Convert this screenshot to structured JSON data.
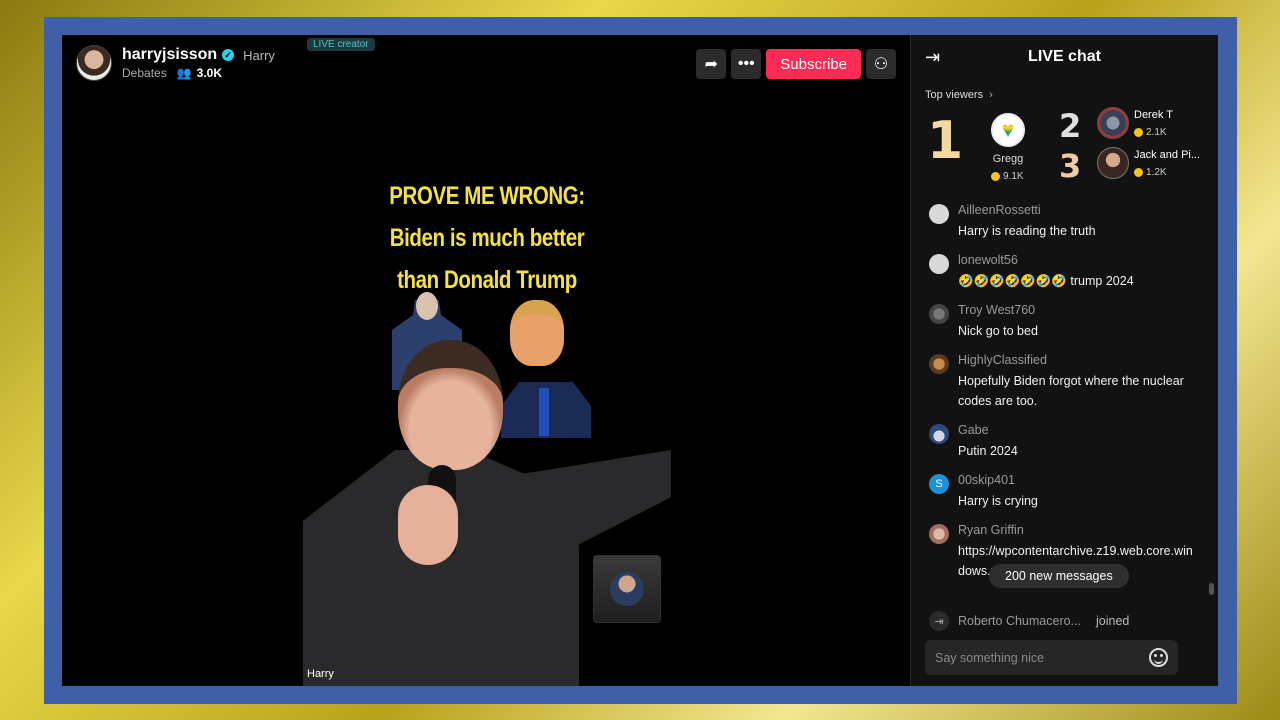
{
  "host": {
    "username": "harryjsisson",
    "nickname": "Harry",
    "category": "Debates",
    "viewer_count": "3.0K",
    "badge": "LIVE creator"
  },
  "actions": {
    "subscribe_label": "Subscribe",
    "share_icon": "share-icon",
    "more_icon": "more-icon",
    "profile_icon": "user-check-icon"
  },
  "stream": {
    "headline_line1": "PROVE ME WRONG:",
    "headline_line2": "Biden is much better",
    "headline_line3": "than Donald Trump",
    "streamer_label": "Harry"
  },
  "chat": {
    "title": "LIVE chat",
    "top_viewers_label": "Top viewers",
    "top_viewers": [
      {
        "rank": "1",
        "name": "Gregg",
        "coins": "9.1K"
      },
      {
        "rank": "2",
        "name": "Derek T",
        "coins": "2.1K"
      },
      {
        "rank": "3",
        "name": "Jack and Pi...",
        "coins": "1.2K"
      }
    ],
    "messages": [
      {
        "user": "AilleenRossetti",
        "text": "Harry is reading the truth"
      },
      {
        "user": "lonewolt56",
        "text": "🤣🤣🤣🤣🤣🤣🤣 trump 2024"
      },
      {
        "user": "Troy West760",
        "text": "Nick go to bed"
      },
      {
        "user": "HighlyClassified",
        "text": "Hopefully Biden forgot where the nuclear codes are too."
      },
      {
        "user": "Gabe",
        "text": "Putin 2024"
      },
      {
        "user": "00skip401",
        "text": "Harry is crying",
        "avatar_letter": "S"
      },
      {
        "user": "Ryan Griffin",
        "text": "https://wpcontentarchive.z19.web.core.windows.net/wp-conte...01.pdf"
      }
    ],
    "new_messages_label": "200 new messages",
    "joined": {
      "user": "Roberto Chumacero...",
      "action": "joined"
    },
    "input_placeholder": "Say something nice"
  },
  "colors": {
    "accent": "#fe2c55",
    "frame": "#3f5fa8",
    "headline": "#f4e04d"
  }
}
